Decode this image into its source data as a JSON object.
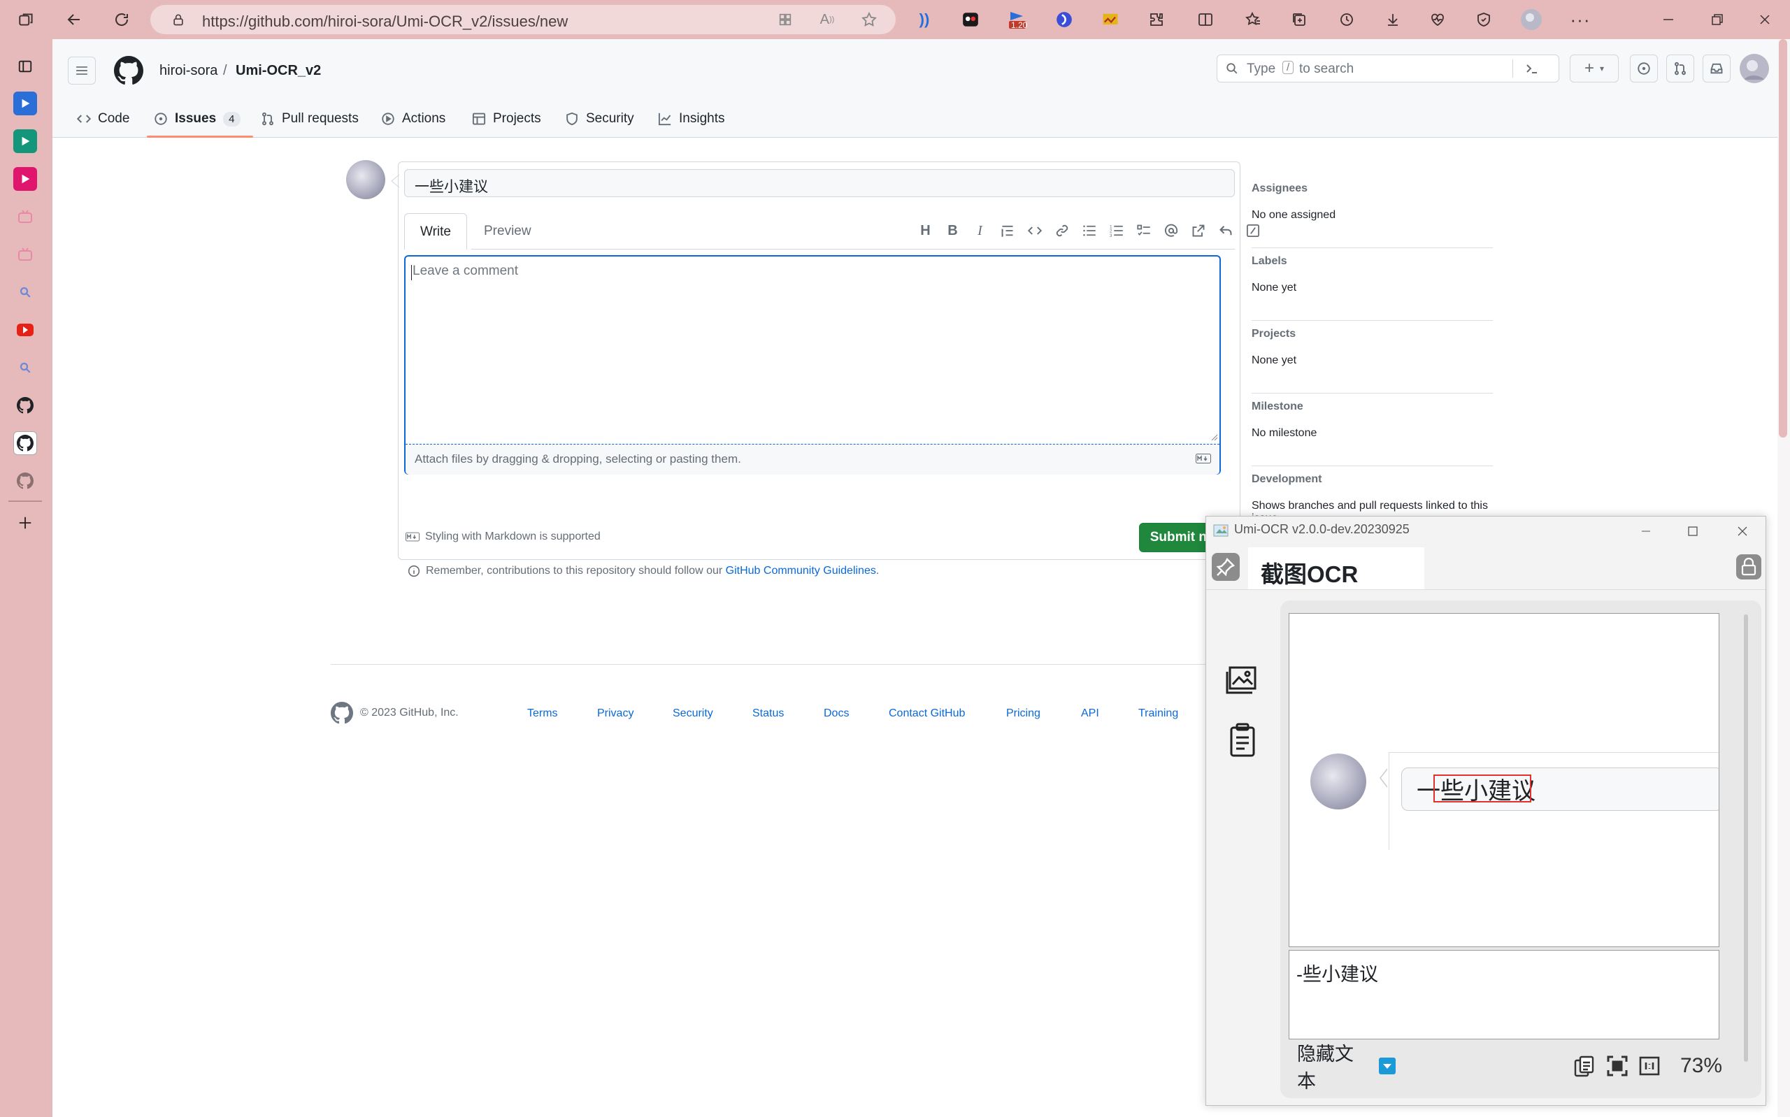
{
  "browser": {
    "url": "https://github.com/hiroi-sora/Umi-OCR_v2/issues/new",
    "badge_count": "1.20"
  },
  "repo": {
    "owner": "hiroi-sora",
    "sep": "/",
    "name": "Umi-OCR_v2"
  },
  "search": {
    "prefix": "Type",
    "key": "/",
    "suffix": "to search"
  },
  "nav_tabs": [
    {
      "label": "Code"
    },
    {
      "label": "Issues",
      "count": "4"
    },
    {
      "label": "Pull requests"
    },
    {
      "label": "Actions"
    },
    {
      "label": "Projects"
    },
    {
      "label": "Security"
    },
    {
      "label": "Insights"
    }
  ],
  "issue": {
    "title": "一些小建议",
    "write_tab": "Write",
    "preview_tab": "Preview",
    "comment_placeholder": "Leave a comment",
    "attach_text": "Attach files by dragging & dropping, selecting or pasting them.",
    "markdown_note": "Styling with Markdown is supported",
    "submit_label": "Submit new issue",
    "remember_text": "Remember, contributions to this repository should follow our",
    "guidelines_link": "GitHub Community Guidelines",
    "period": "."
  },
  "meta": [
    {
      "label": "Assignees",
      "value": "No one assigned"
    },
    {
      "label": "Labels",
      "value": "None yet"
    },
    {
      "label": "Projects",
      "value": "None yet"
    },
    {
      "label": "Milestone",
      "value": "No milestone"
    },
    {
      "label": "Development",
      "value": "Shows branches and pull requests linked to this issue."
    }
  ],
  "footer": {
    "copyright": "© 2023 GitHub, Inc.",
    "links": [
      "Terms",
      "Privacy",
      "Security",
      "Status",
      "Docs",
      "Contact GitHub",
      "Pricing",
      "API",
      "Training"
    ]
  },
  "umi": {
    "window_title": "Umi-OCR v2.0.0-dev.20230925",
    "tab_label": "截图OCR",
    "preview_text": "一些小建议",
    "ocr_result": "-些小建议",
    "hide_text_label": "隐藏文本",
    "zoom": "73%"
  },
  "colors": {
    "primary_button": "#1f883d",
    "link": "#0969da",
    "focus": "#0969da",
    "underline": "#fd8c73"
  }
}
